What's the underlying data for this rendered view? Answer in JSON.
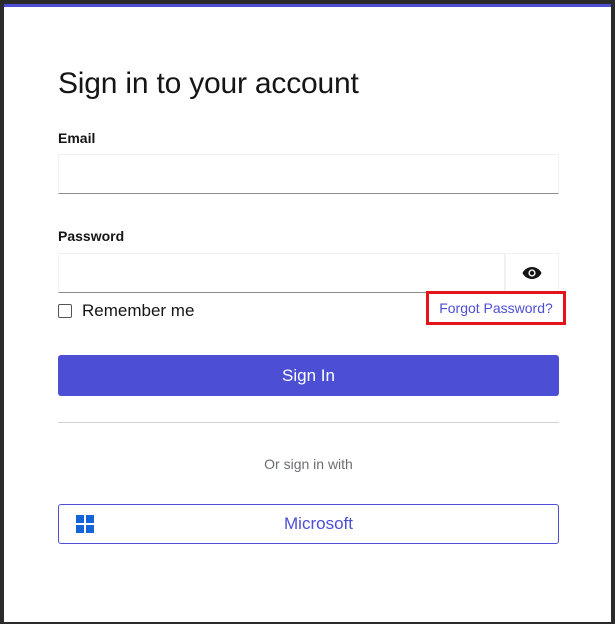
{
  "login": {
    "title": "Sign in to your account",
    "email_label": "Email",
    "email_value": "",
    "password_label": "Password",
    "password_value": "",
    "remember_label": "Remember me",
    "remember_checked": false,
    "forgot_label": "Forgot Password?",
    "signin_label": "Sign In",
    "or_text": "Or sign in with",
    "provider_label": "Microsoft"
  },
  "icons": {
    "password_toggle": "eye-icon",
    "provider_logo": "microsoft-logo-icon"
  },
  "colors": {
    "accent": "#4c4fd4",
    "highlight": "#e3141b",
    "text": "#151515",
    "muted": "#6a6e73"
  }
}
